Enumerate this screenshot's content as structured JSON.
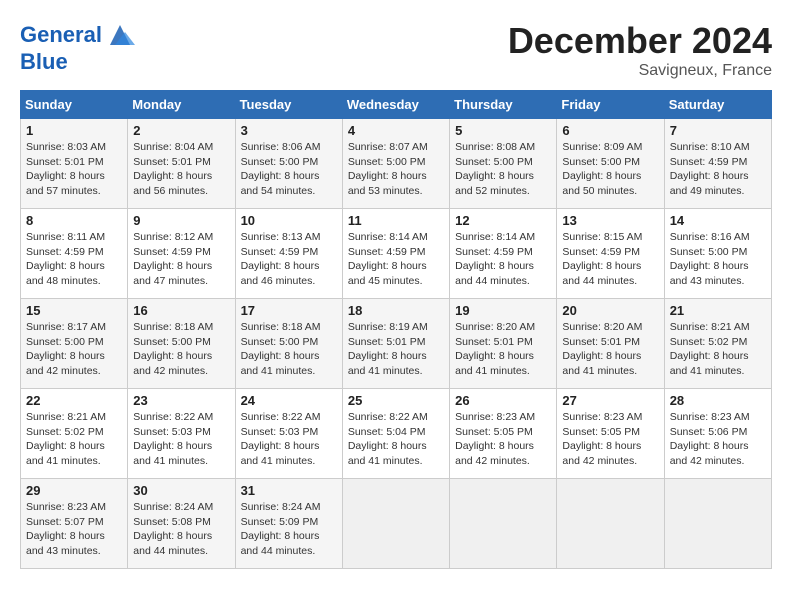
{
  "header": {
    "logo_line1": "General",
    "logo_line2": "Blue",
    "month_title": "December 2024",
    "location": "Savigneux, France"
  },
  "weekdays": [
    "Sunday",
    "Monday",
    "Tuesday",
    "Wednesday",
    "Thursday",
    "Friday",
    "Saturday"
  ],
  "weeks": [
    [
      {
        "day": "1",
        "info": "Sunrise: 8:03 AM\nSunset: 5:01 PM\nDaylight: 8 hours\nand 57 minutes."
      },
      {
        "day": "2",
        "info": "Sunrise: 8:04 AM\nSunset: 5:01 PM\nDaylight: 8 hours\nand 56 minutes."
      },
      {
        "day": "3",
        "info": "Sunrise: 8:06 AM\nSunset: 5:00 PM\nDaylight: 8 hours\nand 54 minutes."
      },
      {
        "day": "4",
        "info": "Sunrise: 8:07 AM\nSunset: 5:00 PM\nDaylight: 8 hours\nand 53 minutes."
      },
      {
        "day": "5",
        "info": "Sunrise: 8:08 AM\nSunset: 5:00 PM\nDaylight: 8 hours\nand 52 minutes."
      },
      {
        "day": "6",
        "info": "Sunrise: 8:09 AM\nSunset: 5:00 PM\nDaylight: 8 hours\nand 50 minutes."
      },
      {
        "day": "7",
        "info": "Sunrise: 8:10 AM\nSunset: 4:59 PM\nDaylight: 8 hours\nand 49 minutes."
      }
    ],
    [
      {
        "day": "8",
        "info": "Sunrise: 8:11 AM\nSunset: 4:59 PM\nDaylight: 8 hours\nand 48 minutes."
      },
      {
        "day": "9",
        "info": "Sunrise: 8:12 AM\nSunset: 4:59 PM\nDaylight: 8 hours\nand 47 minutes."
      },
      {
        "day": "10",
        "info": "Sunrise: 8:13 AM\nSunset: 4:59 PM\nDaylight: 8 hours\nand 46 minutes."
      },
      {
        "day": "11",
        "info": "Sunrise: 8:14 AM\nSunset: 4:59 PM\nDaylight: 8 hours\nand 45 minutes."
      },
      {
        "day": "12",
        "info": "Sunrise: 8:14 AM\nSunset: 4:59 PM\nDaylight: 8 hours\nand 44 minutes."
      },
      {
        "day": "13",
        "info": "Sunrise: 8:15 AM\nSunset: 4:59 PM\nDaylight: 8 hours\nand 44 minutes."
      },
      {
        "day": "14",
        "info": "Sunrise: 8:16 AM\nSunset: 5:00 PM\nDaylight: 8 hours\nand 43 minutes."
      }
    ],
    [
      {
        "day": "15",
        "info": "Sunrise: 8:17 AM\nSunset: 5:00 PM\nDaylight: 8 hours\nand 42 minutes."
      },
      {
        "day": "16",
        "info": "Sunrise: 8:18 AM\nSunset: 5:00 PM\nDaylight: 8 hours\nand 42 minutes."
      },
      {
        "day": "17",
        "info": "Sunrise: 8:18 AM\nSunset: 5:00 PM\nDaylight: 8 hours\nand 41 minutes."
      },
      {
        "day": "18",
        "info": "Sunrise: 8:19 AM\nSunset: 5:01 PM\nDaylight: 8 hours\nand 41 minutes."
      },
      {
        "day": "19",
        "info": "Sunrise: 8:20 AM\nSunset: 5:01 PM\nDaylight: 8 hours\nand 41 minutes."
      },
      {
        "day": "20",
        "info": "Sunrise: 8:20 AM\nSunset: 5:01 PM\nDaylight: 8 hours\nand 41 minutes."
      },
      {
        "day": "21",
        "info": "Sunrise: 8:21 AM\nSunset: 5:02 PM\nDaylight: 8 hours\nand 41 minutes."
      }
    ],
    [
      {
        "day": "22",
        "info": "Sunrise: 8:21 AM\nSunset: 5:02 PM\nDaylight: 8 hours\nand 41 minutes."
      },
      {
        "day": "23",
        "info": "Sunrise: 8:22 AM\nSunset: 5:03 PM\nDaylight: 8 hours\nand 41 minutes."
      },
      {
        "day": "24",
        "info": "Sunrise: 8:22 AM\nSunset: 5:03 PM\nDaylight: 8 hours\nand 41 minutes."
      },
      {
        "day": "25",
        "info": "Sunrise: 8:22 AM\nSunset: 5:04 PM\nDaylight: 8 hours\nand 41 minutes."
      },
      {
        "day": "26",
        "info": "Sunrise: 8:23 AM\nSunset: 5:05 PM\nDaylight: 8 hours\nand 42 minutes."
      },
      {
        "day": "27",
        "info": "Sunrise: 8:23 AM\nSunset: 5:05 PM\nDaylight: 8 hours\nand 42 minutes."
      },
      {
        "day": "28",
        "info": "Sunrise: 8:23 AM\nSunset: 5:06 PM\nDaylight: 8 hours\nand 42 minutes."
      }
    ],
    [
      {
        "day": "29",
        "info": "Sunrise: 8:23 AM\nSunset: 5:07 PM\nDaylight: 8 hours\nand 43 minutes."
      },
      {
        "day": "30",
        "info": "Sunrise: 8:24 AM\nSunset: 5:08 PM\nDaylight: 8 hours\nand 44 minutes."
      },
      {
        "day": "31",
        "info": "Sunrise: 8:24 AM\nSunset: 5:09 PM\nDaylight: 8 hours\nand 44 minutes."
      },
      null,
      null,
      null,
      null
    ]
  ]
}
